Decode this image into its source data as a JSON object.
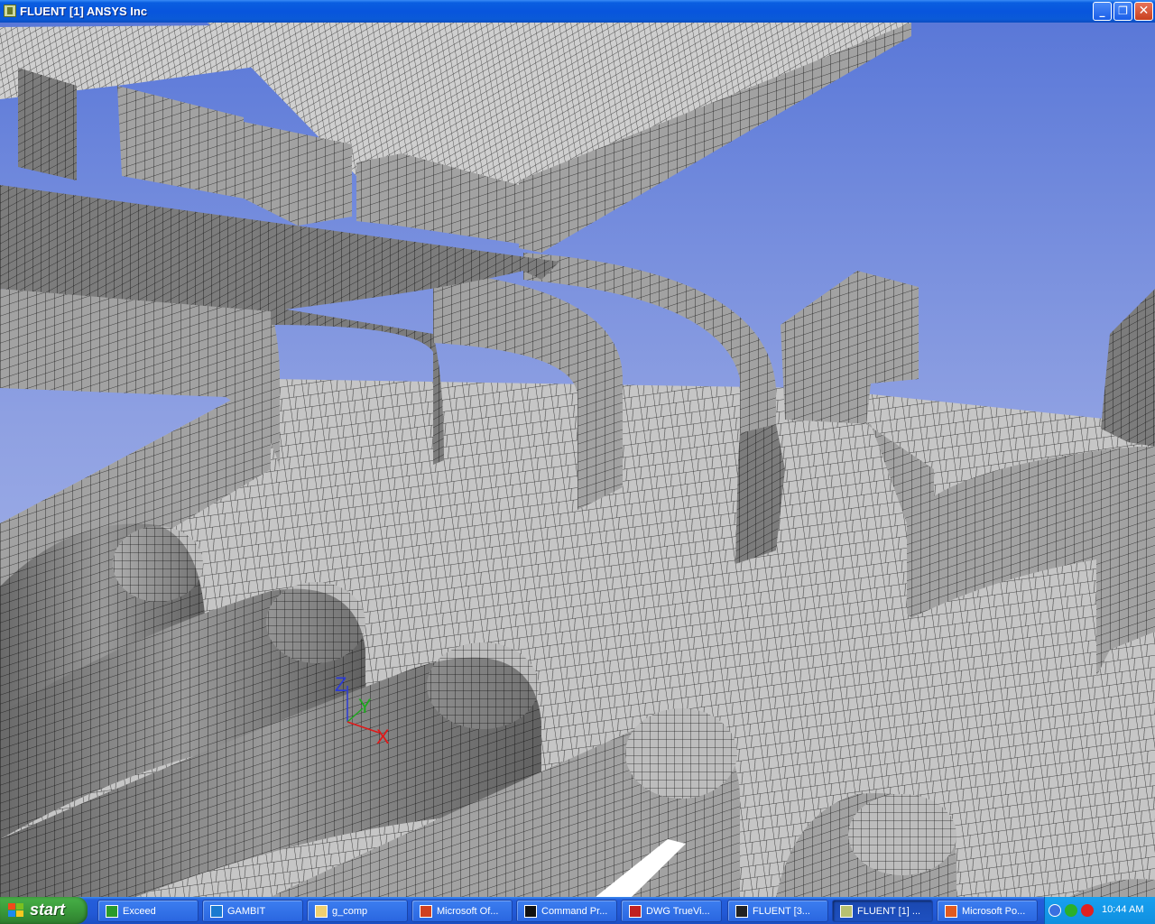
{
  "window": {
    "title": "FLUENT [1] ANSYS Inc",
    "icon": "fluent-app-icon",
    "controls": {
      "minimize": "_",
      "restore": "❐",
      "close": "✕"
    }
  },
  "viewport": {
    "background_top": "#5a78d8",
    "background_bottom": "#b4c0ec",
    "mesh_surface_color": "#b8b8b8",
    "mesh_line_color": "#222222"
  },
  "axes": {
    "z_label": "Z",
    "y_label": "Y",
    "x_label": "X",
    "z_color": "#2a3ad8",
    "y_color": "#1ea81e",
    "x_color": "#e01818"
  },
  "taskbar": {
    "start_label": "start",
    "items": [
      {
        "label": "Exceed",
        "icon": "exceed-icon",
        "icon_color": "#2a9a2a"
      },
      {
        "label": "GAMBIT",
        "icon": "gambit-icon",
        "icon_color": "#1a7ad0"
      },
      {
        "label": "g_comp",
        "icon": "folder-icon",
        "icon_color": "#f0d070"
      },
      {
        "label": "Microsoft Of...",
        "icon": "office-icon",
        "icon_color": "#d04020"
      },
      {
        "label": "Command Pr...",
        "icon": "command-prompt-icon",
        "icon_color": "#111111"
      },
      {
        "label": "DWG TrueVi...",
        "icon": "dwg-icon",
        "icon_color": "#c02020"
      },
      {
        "label": "FLUENT  [3...",
        "icon": "fluent-icon",
        "icon_color": "#222222"
      },
      {
        "label": "FLUENT [1] ...",
        "icon": "fluent-icon",
        "icon_color": "#b8c070",
        "active": true
      },
      {
        "label": "Microsoft Po...",
        "icon": "powerpoint-icon",
        "icon_color": "#e05a20"
      }
    ],
    "tray_icons": [
      "tray-expand-icon",
      "tray-network-icon",
      "tray-antivirus-icon"
    ],
    "clock": "10:44 AM"
  }
}
